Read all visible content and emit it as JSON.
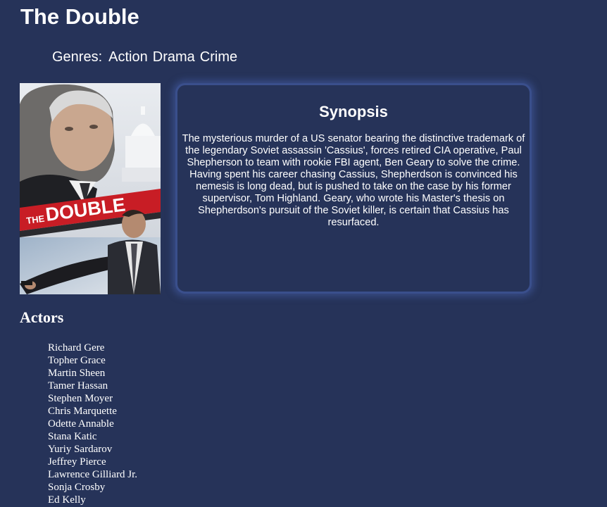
{
  "movie": {
    "title": "The Double",
    "genres_label": "Genres:",
    "genres": [
      "Action",
      "Drama",
      "Crime"
    ],
    "poster": {
      "brand_the": "THE",
      "brand_title": "DOUBLE"
    }
  },
  "synopsis": {
    "heading": "Synopsis",
    "text": "The mysterious murder of a US senator bearing the distinctive trademark of the legendary Soviet assassin 'Cassius', forces retired CIA operative, Paul Shepherson to team with rookie FBI agent, Ben Geary to solve the crime. Having spent his career chasing Cassius, Shepherdson is convinced his nemesis is long dead, but is pushed to take on the case by his former supervisor, Tom Highland. Geary, who wrote his Master's thesis on Shepherdson's pursuit of the Soviet killer, is certain that Cassius has resurfaced."
  },
  "actors": {
    "heading": "Actors",
    "names": [
      "Richard Gere",
      "Topher Grace",
      "Martin Sheen",
      "Tamer Hassan",
      "Stephen Moyer",
      "Chris Marquette",
      "Odette Annable",
      "Stana Katic",
      "Yuriy Sardarov",
      "Jeffrey Pierce",
      "Lawrence Gilliard Jr.",
      "Sonja Crosby",
      "Ed Kelly"
    ]
  },
  "colors": {
    "background": "#263359",
    "text": "#ffffff",
    "box_border": "#3a4f8c",
    "poster_red": "#c81d25"
  }
}
